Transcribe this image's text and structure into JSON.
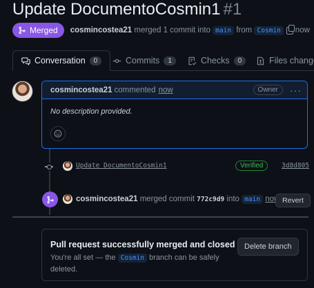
{
  "title": "Update DocumentoCosmin1",
  "pr_number": "#1",
  "status_badge": "Merged",
  "meta": {
    "author": "cosmincostea21",
    "merged_text": "merged 1 commit into",
    "base_branch": "main",
    "from_text": "from",
    "head_branch": "Cosmin",
    "time": "now"
  },
  "tabs": [
    {
      "label": "Conversation",
      "count": "0",
      "icon": "conversation-icon"
    },
    {
      "label": "Commits",
      "count": "1",
      "icon": "commit-icon"
    },
    {
      "label": "Checks",
      "count": "0",
      "icon": "checklist-icon"
    },
    {
      "label": "Files changed",
      "icon": "file-diff-icon"
    }
  ],
  "comment": {
    "author": "cosmincostea21",
    "action": "commented",
    "time": "now",
    "role_badge": "Owner",
    "body": "No description provided."
  },
  "commit": {
    "message": "Update DocumentoCosmin1",
    "verified": "Verified",
    "sha": "3d8d805"
  },
  "merge_event": {
    "author": "cosmincostea21",
    "text": "merged commit",
    "sha": "772c9d9",
    "into_text": "into",
    "branch": "main",
    "time": "now",
    "revert_label": "Revert"
  },
  "merged_box": {
    "title": "Pull request successfully merged and closed",
    "desc_before": "You're all set — the",
    "branch": "Cosmin",
    "desc_after": "branch can be safely deleted.",
    "delete_label": "Delete branch"
  },
  "colors": {
    "merged_purple": "#8957e5",
    "link_blue": "#4493f8",
    "verified_green": "#3fb950",
    "background": "#0d1117"
  }
}
